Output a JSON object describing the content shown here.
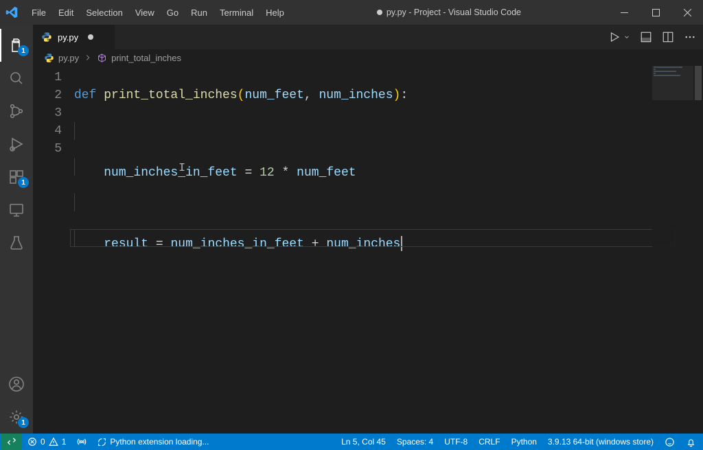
{
  "title": "py.py - Project - Visual Studio Code",
  "title_dirty": true,
  "menu": [
    "File",
    "Edit",
    "Selection",
    "View",
    "Go",
    "Run",
    "Terminal",
    "Help"
  ],
  "tab": {
    "label": "py.py",
    "dirty": true
  },
  "breadcrumb": {
    "file": "py.py",
    "symbol": "print_total_inches"
  },
  "activity_badges": {
    "explorer": "1",
    "extensions": "1",
    "settings": "1"
  },
  "code": {
    "fn_kw": "def",
    "fn_name": "print_total_inches",
    "params": [
      "num_feet",
      "num_inches"
    ],
    "line3_lhs": "num_inches_in_feet",
    "line3_eq": "=",
    "line3_num": "12",
    "line3_mul": "*",
    "line3_rhs": "num_feet",
    "line5_lhs": "result",
    "line5_eq": "=",
    "line5_a": "num_inches_in_feet",
    "line5_plus": "+",
    "line5_b": "num_inches"
  },
  "gutter": [
    "1",
    "2",
    "3",
    "4",
    "5"
  ],
  "statusbar": {
    "errors": "0",
    "warnings": "1",
    "py_ext": "Python extension loading...",
    "ln_col": "Ln 5, Col 45",
    "spaces": "Spaces: 4",
    "encoding": "UTF-8",
    "eol": "CRLF",
    "lang": "Python",
    "interpreter": "3.9.13 64-bit (windows store)"
  }
}
